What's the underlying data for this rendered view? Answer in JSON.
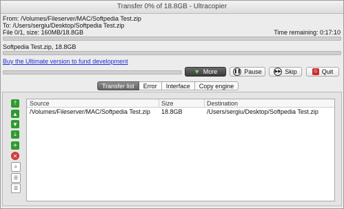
{
  "window": {
    "title": "Transfer 0% of 18.8GB - Ultracopier"
  },
  "info": {
    "from": "From: /Volumes/Fileserver/MAC/Softpedia Test.zip",
    "to": "To: /Users/sergiu/Desktop/Softpedia Test.zip",
    "file_status": "File 0/1, size: 160MB/18.8GB",
    "time_remaining": "Time remaining: 0:17:10",
    "current_file": "Softpedia Test.zip, 18.8GB"
  },
  "progress": {
    "overall": 0.0,
    "current": 0.0
  },
  "link": {
    "text": "Buy the Ultimate version to fund development"
  },
  "actions": {
    "more": "More",
    "pause": "Pause",
    "skip": "Skip",
    "quit": "Quit"
  },
  "tabs": [
    "Transfer list",
    "Error",
    "Interface",
    "Copy engine"
  ],
  "active_tab": "Transfer list",
  "table": {
    "columns": [
      "Source",
      "Size",
      "Destination"
    ],
    "rows": [
      {
        "source": "/Volumes/Fileserver/MAC/Softpedia Test.zip",
        "size": "18.8GB",
        "destination": "/Users/sergiu/Desktop/Softpedia Test.zip"
      }
    ]
  },
  "side_tools": [
    "move-top-icon",
    "move-up-icon",
    "move-down-icon",
    "move-bottom-icon",
    "add-icon",
    "remove-icon",
    "search-icon",
    "import-list-icon",
    "export-list-icon"
  ],
  "colors": {
    "link": "#1a2bdc",
    "progress": "#4a90d9",
    "arrow_green": "#2e9b2e",
    "remove_red": "#d23b3b",
    "quit_red": "#cc2b2b"
  }
}
